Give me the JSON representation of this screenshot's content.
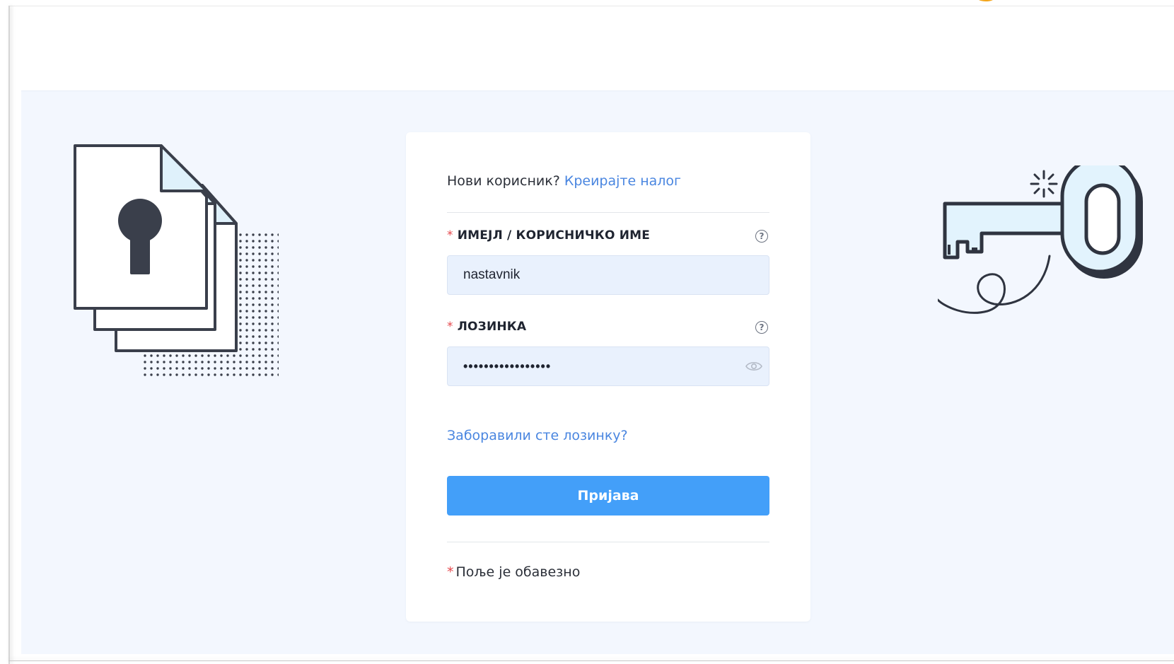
{
  "signup": {
    "prompt": "Нови корисник?",
    "link": "Креирајте налог"
  },
  "username": {
    "label": "ИМЕЈЛ / КОРИСНИЧКО ИМЕ",
    "value": "nastavnik",
    "required_mark": "*",
    "help_icon": "question-circle-icon"
  },
  "password": {
    "label": "ЛОЗИНКА",
    "value": "•••••••••••••••••",
    "required_mark": "*",
    "help_icon": "question-circle-icon",
    "toggle_icon": "eye-icon"
  },
  "forgot_link": "Заборавили сте лозинку?",
  "login_button": "Пријава",
  "required_note": {
    "mark": "*",
    "text": "Поље је обавезно"
  },
  "colors": {
    "accent": "#439ff9",
    "link": "#4a86e0",
    "required": "#e5484d",
    "hero_background": "#f3f7fe",
    "input_background": "#e9f1fd"
  },
  "illustrations": [
    "documents-keyhole-icon",
    "key-icon"
  ]
}
